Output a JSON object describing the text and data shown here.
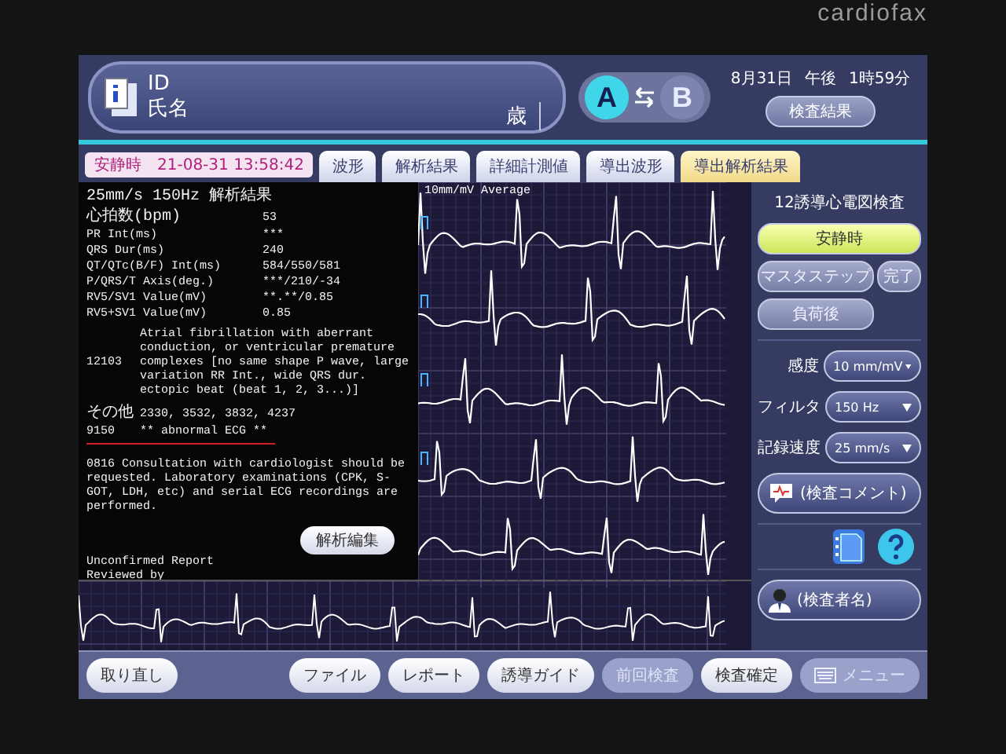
{
  "device": {
    "logo": "cardiofax"
  },
  "patient": {
    "id_label": "ID",
    "name_label": "氏名",
    "age_unit": "歳"
  },
  "ab_switch": [
    {
      "label": "A",
      "selected": true
    },
    {
      "label": "B",
      "selected": false
    }
  ],
  "clock": {
    "date": "8月31日",
    "period": "午後",
    "time": "1時59分"
  },
  "results_button": "検査結果",
  "status": {
    "phase": "安静時",
    "timestamp": "21-08-31 13:58:42"
  },
  "tabs": [
    {
      "label": "波形",
      "selected": false
    },
    {
      "label": "解析結果",
      "selected": false
    },
    {
      "label": "詳細計測値",
      "selected": false
    },
    {
      "label": "導出波形",
      "selected": false
    },
    {
      "label": "導出解析結果",
      "selected": true
    }
  ],
  "report": {
    "header": "25mm/s 150Hz 解析結果",
    "measurements": [
      {
        "label": "心拍数(bpm)",
        "value": "53"
      },
      {
        "label": "PR Int(ms)",
        "value": "***"
      },
      {
        "label": "QRS Dur(ms)",
        "value": "240"
      },
      {
        "label": "QT/QTc(B/F) Int(ms)",
        "value": "584/550/581"
      },
      {
        "label": "P/QRS/T Axis(deg.)",
        "value": "***/210/-34"
      },
      {
        "label": "RV5/SV1 Value(mV)",
        "value": "**.**/0.85"
      },
      {
        "label": "RV5+SV1 Value(mV)",
        "value": "0.85"
      }
    ],
    "finding": {
      "code": "12103",
      "text": "Atrial fibrillation with aberrant conduction, or ventricular premature complexes [no same shape P wave, large variation RR Int., wide QRS dur. ectopic beat (beat 1, 2, 3...)]"
    },
    "other": {
      "label": "その他",
      "value": "2330, 3532, 3832, 4237"
    },
    "classification": {
      "code": "9150",
      "text": "** abnormal ECG **"
    },
    "recommendation": {
      "code": "0816",
      "text": "Consultation with cardiologist should be requested. Laboratory examinations (CPK, S-GOT, LDH, etc) and serial ECG recordings are performed."
    },
    "edit_button": "解析編集",
    "footer": [
      "Unconfirmed Report",
      "Reviewed by"
    ]
  },
  "waveform": {
    "scale_label": "10mm/mV Average"
  },
  "exam": {
    "title": "12誘導心電図検査",
    "stages": [
      {
        "label": "安静時",
        "selected": true
      },
      {
        "label": "マスタステップ",
        "selected": false
      },
      {
        "label": "完了",
        "selected": false
      },
      {
        "label": "負荷後",
        "selected": false
      }
    ]
  },
  "settings": [
    {
      "label": "感度",
      "value": "10 mm/mV"
    },
    {
      "label": "フィルタ",
      "value": "150 Hz"
    },
    {
      "label": "記録速度",
      "value": "25 mm/s"
    }
  ],
  "comment_button": "(検査コメント)",
  "examiner_button": "(検査者名)",
  "bottom_buttons": [
    {
      "label": "取り直し",
      "disabled": false
    },
    {
      "label": "ファイル",
      "disabled": false
    },
    {
      "label": "レポート",
      "disabled": false
    },
    {
      "label": "誘導ガイド",
      "disabled": false
    },
    {
      "label": "前回検査",
      "disabled": true
    },
    {
      "label": "検査確定",
      "disabled": false
    },
    {
      "label": "メニュー",
      "disabled": true
    }
  ]
}
